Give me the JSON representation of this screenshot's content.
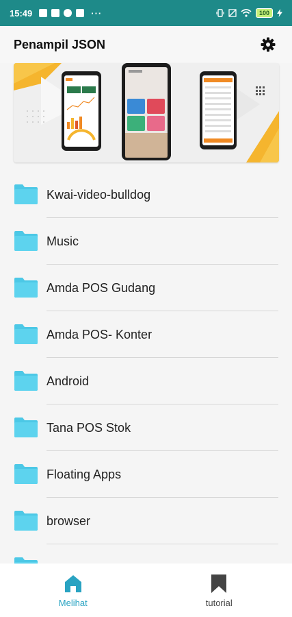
{
  "status_bar": {
    "time": "15:49",
    "more_indicator": "···",
    "battery": "100"
  },
  "header": {
    "title": "Penampil JSON",
    "settings_icon": "gear-icon"
  },
  "files": [
    {
      "name": "Kwai-video-bulldog",
      "icon": "folder-icon"
    },
    {
      "name": "Music",
      "icon": "folder-icon"
    },
    {
      "name": "Amda POS Gudang",
      "icon": "folder-icon"
    },
    {
      "name": "Amda POS- Konter",
      "icon": "folder-icon"
    },
    {
      "name": "Android",
      "icon": "folder-icon"
    },
    {
      "name": "Tana POS Stok",
      "icon": "folder-icon"
    },
    {
      "name": "Floating Apps",
      "icon": "folder-icon"
    },
    {
      "name": "browser",
      "icon": "folder-icon"
    }
  ],
  "bottom_nav": {
    "tabs": [
      {
        "label": "Melihat",
        "icon": "home-icon",
        "active": true
      },
      {
        "label": "tutorial",
        "icon": "bookmark-icon",
        "active": false
      }
    ]
  },
  "colors": {
    "status_bar": "#1e8a89",
    "accent": "#29a3c2",
    "folder": "#4cc8e6"
  }
}
